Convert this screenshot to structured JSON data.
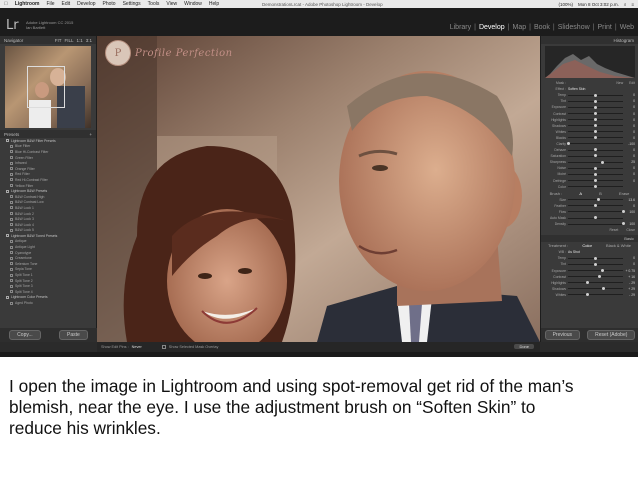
{
  "menubar": {
    "apple": "",
    "app": "Lightroom",
    "items": [
      "File",
      "Edit",
      "Develop",
      "Photo",
      "Settings",
      "Tools",
      "View",
      "Window",
      "Help"
    ],
    "window_title": "DemonstrationLrcat - Adobe Photoshop Lightroom - Develop",
    "battery": "(100%)",
    "clock": "Mon 8 Oct 3:02 p.m."
  },
  "header": {
    "logo": "Lr",
    "product": "Adobe Lightroom CC 2015",
    "user": "Ian Bartlett",
    "modules": [
      "Library",
      "Develop",
      "Map",
      "Book",
      "Slideshow",
      "Print",
      "Web"
    ],
    "active_module": "Develop"
  },
  "left_panel": {
    "navigator_title": "Navigator",
    "navigator_zoom": [
      "FIT",
      "FILL",
      "1:1",
      "3:1"
    ],
    "presets_title": "Presets",
    "presets": [
      {
        "label": "Lightroom B&W Filter Presets",
        "folder": true
      },
      {
        "label": "Blue Filter",
        "folder": false
      },
      {
        "label": "Blue Hi-Contrast Filter",
        "folder": false
      },
      {
        "label": "Green Filter",
        "folder": false
      },
      {
        "label": "Infrared",
        "folder": false
      },
      {
        "label": "Orange Filter",
        "folder": false
      },
      {
        "label": "Red Filter",
        "folder": false
      },
      {
        "label": "Red Hi-Contrast Filter",
        "folder": false
      },
      {
        "label": "Yellow Filter",
        "folder": false
      },
      {
        "label": "Lightroom B&W Presets",
        "folder": true
      },
      {
        "label": "B&W Contrast High",
        "folder": false
      },
      {
        "label": "B&W Contrast Low",
        "folder": false
      },
      {
        "label": "B&W Look 1",
        "folder": false
      },
      {
        "label": "B&W Look 2",
        "folder": false
      },
      {
        "label": "B&W Look 3",
        "folder": false
      },
      {
        "label": "B&W Look 4",
        "folder": false
      },
      {
        "label": "B&W Look 5",
        "folder": false
      },
      {
        "label": "Lightroom B&W Toned Presets",
        "folder": true
      },
      {
        "label": "Antique",
        "folder": false
      },
      {
        "label": "Antique Light",
        "folder": false
      },
      {
        "label": "Cyanotype",
        "folder": false
      },
      {
        "label": "Creamtone",
        "folder": false
      },
      {
        "label": "Selenium Tone",
        "folder": false
      },
      {
        "label": "Sepia Tone",
        "folder": false
      },
      {
        "label": "Split Tone 1",
        "folder": false
      },
      {
        "label": "Split Tone 2",
        "folder": false
      },
      {
        "label": "Split Tone 3",
        "folder": false
      },
      {
        "label": "Split Tone 4",
        "folder": false
      },
      {
        "label": "Lightroom Color Presets",
        "folder": true
      },
      {
        "label": "Aged Photo",
        "folder": false
      }
    ],
    "copy_button": "Copy...",
    "paste_button": "Paste"
  },
  "photo": {
    "watermark": "Profile Perfection",
    "watermark_mark": "P"
  },
  "right_panel": {
    "histogram_title": "Histogram",
    "mask_labels": [
      "Mask :",
      "New",
      "Edit"
    ],
    "effect_label": "Effect :",
    "effect_value": "Soften Skin",
    "sliders_a": [
      {
        "label": "Temp",
        "value": "0",
        "pos": 0.5
      },
      {
        "label": "Tint",
        "value": "0",
        "pos": 0.5
      },
      {
        "label": "Exposure",
        "value": "0",
        "pos": 0.5
      },
      {
        "label": "Contrast",
        "value": "0",
        "pos": 0.5
      },
      {
        "label": "Highlights",
        "value": "0",
        "pos": 0.5
      },
      {
        "label": "Shadows",
        "value": "0",
        "pos": 0.5
      },
      {
        "label": "Whites",
        "value": "0",
        "pos": 0.5
      },
      {
        "label": "Blacks",
        "value": "0",
        "pos": 0.5
      },
      {
        "label": "Clarity",
        "value": "-100",
        "pos": 0.0
      },
      {
        "label": "Dehaze",
        "value": "0",
        "pos": 0.5
      },
      {
        "label": "Saturation",
        "value": "0",
        "pos": 0.5
      },
      {
        "label": "Sharpness",
        "value": "25",
        "pos": 0.62
      },
      {
        "label": "Noise",
        "value": "0",
        "pos": 0.5
      },
      {
        "label": "Moiré",
        "value": "0",
        "pos": 0.5
      },
      {
        "label": "Defringe",
        "value": "0",
        "pos": 0.5
      },
      {
        "label": "Color",
        "value": "",
        "pos": 0.5
      }
    ],
    "brush_tabs": [
      "Brush :",
      "A",
      "B",
      "Erase"
    ],
    "sliders_b": [
      {
        "label": "Size",
        "value": "13.6",
        "pos": 0.55
      },
      {
        "label": "Feather",
        "value": "0",
        "pos": 0.5
      },
      {
        "label": "Flow",
        "value": "100",
        "pos": 1.0
      },
      {
        "label": "Auto Mask",
        "value": "",
        "pos": 0.5
      },
      {
        "label": "Density",
        "value": "100",
        "pos": 1.0
      }
    ],
    "reset_label": "Reset",
    "close_label": "Close",
    "basic_title": "Basic",
    "treatment_tabs": [
      "Treatment :",
      "Color",
      "Black & White"
    ],
    "wb_label": "WB :",
    "wb_value": "As Shot",
    "sliders_c": [
      {
        "label": "Temp",
        "value": "0",
        "pos": 0.5
      },
      {
        "label": "Tint",
        "value": "0",
        "pos": 0.5
      },
      {
        "label": "Exposure",
        "value": "+ 0.75",
        "pos": 0.62
      },
      {
        "label": "Contrast",
        "value": "+ 16",
        "pos": 0.58
      },
      {
        "label": "Highlights",
        "value": "- 29",
        "pos": 0.36
      },
      {
        "label": "Shadows",
        "value": "+ 29",
        "pos": 0.64
      },
      {
        "label": "Whites",
        "value": "- 29",
        "pos": 0.36
      }
    ],
    "previous_button": "Previous",
    "reset_adobe_button": "Reset (Adobe)"
  },
  "toolbar": {
    "show_edit_pins_label": "Show Edit Pins :",
    "show_edit_pins_value": "Never",
    "overlay_label": "Show Selected Mask Overlay",
    "done_button": "Done"
  },
  "caption": {
    "line1": "I open the image in Lightroom and using spot-removal get rid of the man’s",
    "line2": "blemish, near the eye.  I use the adjustment brush on “Soften Skin” to",
    "line3": "reduce his wrinkles."
  }
}
